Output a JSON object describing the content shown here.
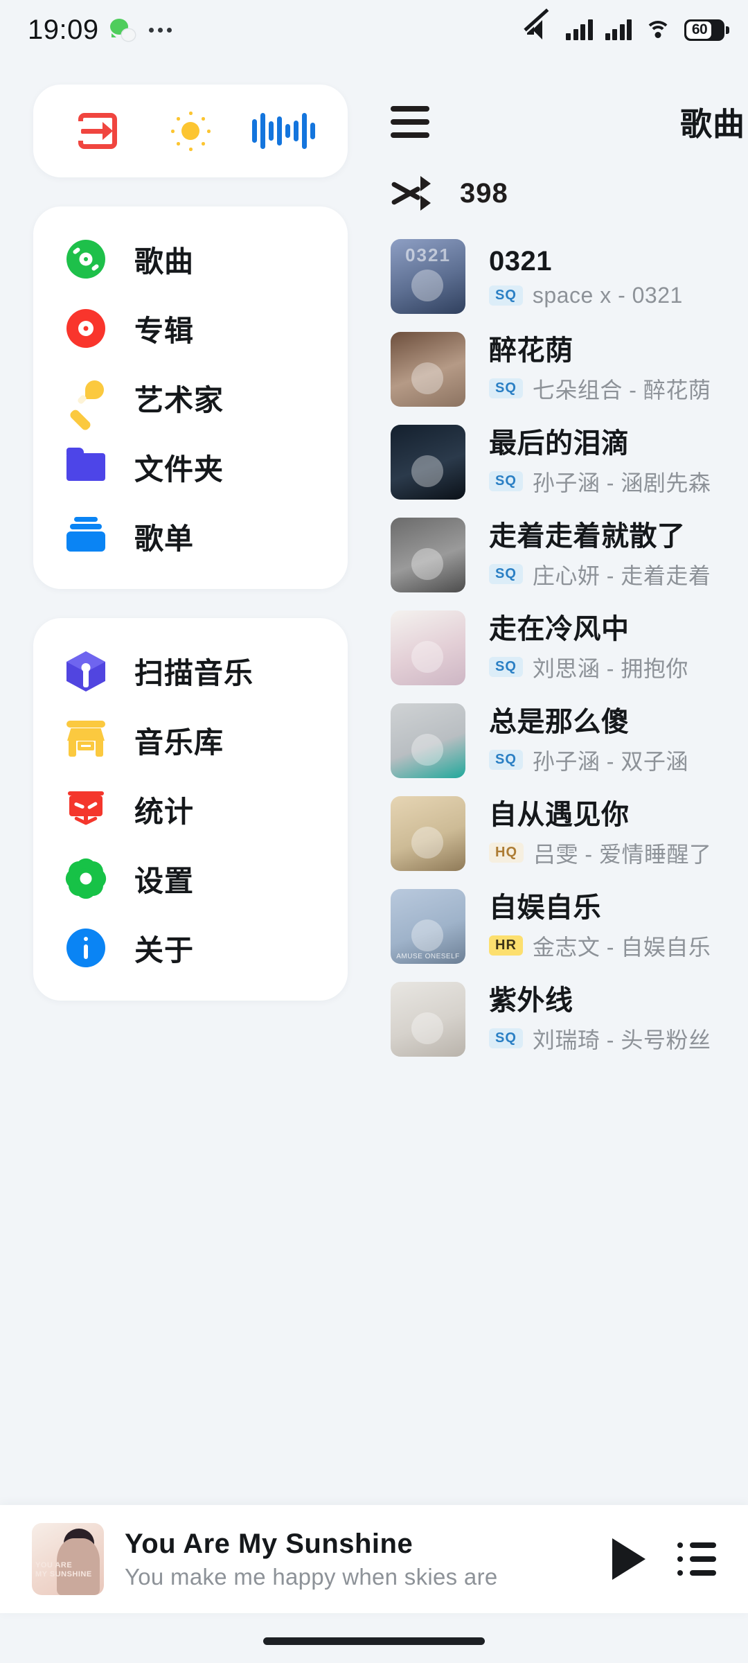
{
  "status_bar": {
    "time": "19:09",
    "battery_percent": "60",
    "icons": [
      "wechat-icon",
      "overflow-dots-icon",
      "mute-icon",
      "signal-icon",
      "signal-icon-2",
      "wifi-icon",
      "battery-icon"
    ]
  },
  "sidebar": {
    "quick_actions": [
      {
        "name": "exit-icon",
        "color": "#f0453f"
      },
      {
        "name": "sun-icon",
        "color": "#fcc531"
      },
      {
        "name": "waveform-icon",
        "color": "#1475dd"
      }
    ],
    "group_1": [
      {
        "label": "歌曲",
        "icon": "green-disc-icon",
        "color": "#1ec04a"
      },
      {
        "label": "专辑",
        "icon": "red-disc-icon",
        "color": "#f9352c"
      },
      {
        "label": "艺术家",
        "icon": "microphone-icon",
        "color": "#fbc93f"
      },
      {
        "label": "文件夹",
        "icon": "folder-icon",
        "color": "#4d45e8"
      },
      {
        "label": "歌单",
        "icon": "playlist-stack-icon",
        "color": "#0a84f4"
      }
    ],
    "group_2": [
      {
        "label": "扫描音乐",
        "icon": "cube-scan-icon",
        "color": "#5145e0"
      },
      {
        "label": "音乐库",
        "icon": "shop-icon",
        "color": "#fbc93f"
      },
      {
        "label": "统计",
        "icon": "chart-board-icon",
        "color": "#f4362c"
      },
      {
        "label": "设置",
        "icon": "gear-icon",
        "color": "#17c247"
      },
      {
        "label": "关于",
        "icon": "info-icon",
        "color": "#0a84f4"
      }
    ]
  },
  "main": {
    "menu_icon": "hamburger-menu-icon",
    "title": "歌曲",
    "shuffle_icon": "shuffle-icon",
    "song_count": "398",
    "songs": [
      {
        "title": "0321",
        "badge": "SQ",
        "badge_type": "sq",
        "artist": "space x - 0321",
        "cover_caption": "0321",
        "cover_c1": "#8e9fc4",
        "cover_c2": "#5d6f92",
        "cover_c3": "#30405e"
      },
      {
        "title": "醉花荫",
        "badge": "SQ",
        "badge_type": "sq",
        "artist": "七朵组合 - 醉花荫",
        "cover_caption": "",
        "cover_c1": "#6d4f3d",
        "cover_c2": "#b59a86",
        "cover_c3": "#8c7361"
      },
      {
        "title": "最后的泪滴",
        "badge": "SQ",
        "badge_type": "sq",
        "artist": "孙子涵 - 涵剧先森",
        "cover_caption": "",
        "cover_c1": "#14202e",
        "cover_c2": "#2b3a4b",
        "cover_c3": "#0b1118"
      },
      {
        "title": "走着走着就散了",
        "badge": "SQ",
        "badge_type": "sq",
        "artist": "庄心妍 - 走着走着",
        "cover_caption": "",
        "cover_c1": "#6b6b6b",
        "cover_c2": "#9a9a9a",
        "cover_c3": "#4c4c4c"
      },
      {
        "title": "走在冷风中",
        "badge": "SQ",
        "badge_type": "sq",
        "artist": "刘思涵 - 拥抱你",
        "cover_caption": "",
        "cover_c1": "#f4f2ef",
        "cover_c2": "#e3cfd6",
        "cover_c3": "#cdb6c4"
      },
      {
        "title": "总是那么傻",
        "badge": "SQ",
        "badge_type": "sq",
        "artist": "孙子涵 - 双子涵",
        "cover_caption": "",
        "cover_c1": "#cfd2d4",
        "cover_c2": "#b9bec2",
        "cover_c3": "#21a89b"
      },
      {
        "title": "自从遇见你",
        "badge": "HQ",
        "badge_type": "hq",
        "artist": "吕雯 - 爱情睡醒了",
        "cover_caption": "",
        "cover_c1": "#e6d5b4",
        "cover_c2": "#cdbb96",
        "cover_c3": "#8f7a58"
      },
      {
        "title": "自娱自乐",
        "badge": "HR",
        "badge_type": "hr",
        "artist": "金志文 - 自娱自乐",
        "cover_caption": "AMUSE ONESELF",
        "cover_c1": "#b9c9dd",
        "cover_c2": "#9fb3ca",
        "cover_c3": "#6c7f95"
      },
      {
        "title": "紫外线",
        "badge": "SQ",
        "badge_type": "sq",
        "artist": "刘瑞琦 - 头号粉丝",
        "cover_caption": "",
        "cover_c1": "#e8e6e2",
        "cover_c2": "#d6d2cc",
        "cover_c3": "#b9b3ab"
      }
    ]
  },
  "now_playing": {
    "title": "You Are My Sunshine",
    "lyric": "You make me happy when skies are",
    "cover_line_1": "YOU ARE",
    "cover_line_2": "MY SUNSHINE",
    "play_icon": "play-icon",
    "queue_icon": "queue-list-icon"
  }
}
